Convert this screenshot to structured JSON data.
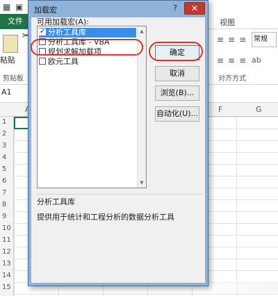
{
  "excel": {
    "file_tab": "文件",
    "view_tab": "视图",
    "paste_label": "粘贴",
    "clipboard_group": "剪贴板",
    "cell_style_button": "常规",
    "alignment_group": "对齐方式",
    "name_box": "A1",
    "columns": [
      "A",
      "F",
      "G"
    ],
    "rows": [
      "1",
      "2",
      "3",
      "4",
      "5",
      "6",
      "7",
      "8",
      "9",
      "10",
      "11",
      "12",
      "13",
      "14",
      "15"
    ]
  },
  "dialog": {
    "title": "加载宏",
    "help_label": "?",
    "close_label": "✕",
    "list_label": "可用加载宏(A):",
    "addins": [
      {
        "label": "分析工具库",
        "checked": true,
        "selected": true
      },
      {
        "label": "分析工具库 - VBA",
        "checked": false,
        "selected": false
      },
      {
        "label": "规划求解加载项",
        "checked": false,
        "selected": false
      },
      {
        "label": "欧元工具",
        "checked": false,
        "selected": false
      }
    ],
    "buttons": {
      "ok": "确定",
      "cancel": "取消",
      "browse": "浏览(B)...",
      "automation": "自动化(U)..."
    },
    "description": {
      "title": "分析工具库",
      "text": "提供用于统计和工程分析的数据分析工具"
    }
  },
  "colors": {
    "excel_green": "#217346",
    "dialog_frame": "#8fb2d8",
    "selection": "#3a8ee6",
    "highlight_oval": "#d9302a"
  }
}
